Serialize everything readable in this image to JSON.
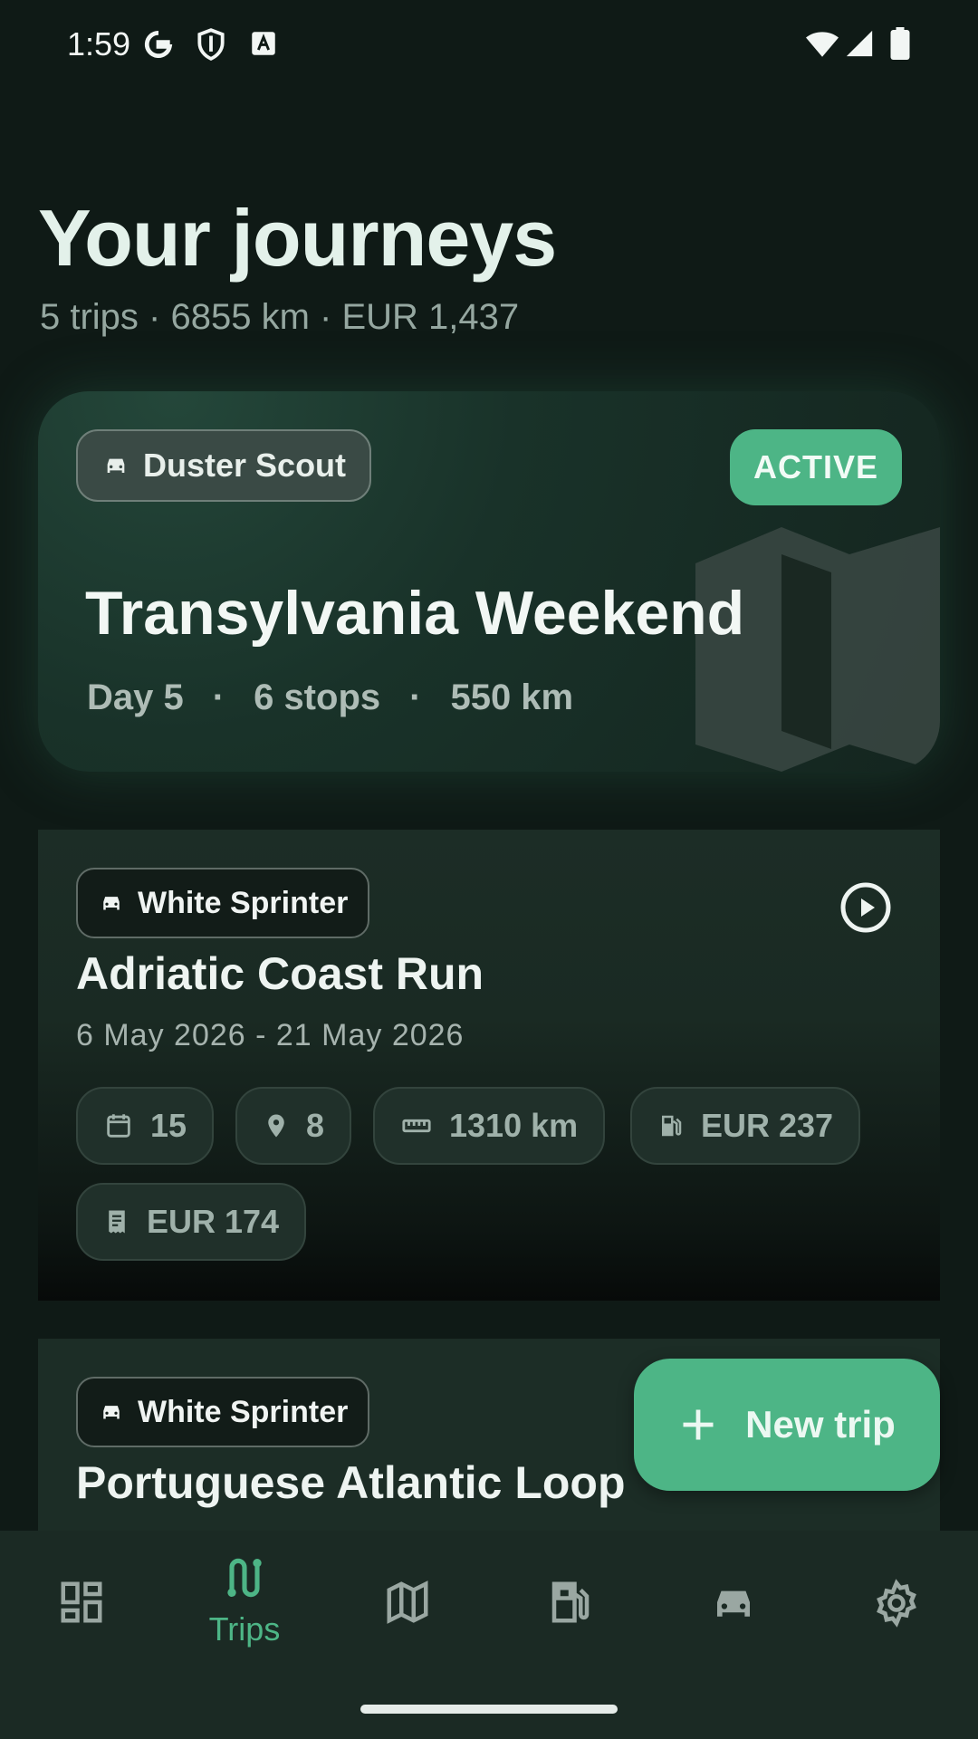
{
  "status": {
    "time": "1:59"
  },
  "header": {
    "title": "Your journeys",
    "summary": "5 trips · 6855 km · EUR 1,437"
  },
  "active_trip": {
    "vehicle": "Duster Scout",
    "badge": "ACTIVE",
    "title": "Transylvania Weekend",
    "day": "Day 5",
    "stops": "6 stops",
    "distance": "550 km",
    "separator": "·"
  },
  "trips": [
    {
      "vehicle": "White Sprinter",
      "title": "Adriatic Coast Run",
      "dates": "6 May 2026 - 21 May 2026",
      "chips": {
        "days": "15",
        "stops": "8",
        "distance": "1310 km",
        "fuel": "EUR 237",
        "tolls": "EUR 174"
      }
    },
    {
      "vehicle": "White Sprinter",
      "title": "Portuguese Atlantic Loop"
    }
  ],
  "fab": {
    "label": "New trip"
  },
  "nav": {
    "items": [
      {
        "icon": "dashboard-icon"
      },
      {
        "icon": "route-icon",
        "label": "Trips",
        "active": true
      },
      {
        "icon": "map-icon"
      },
      {
        "icon": "fuel-station-icon"
      },
      {
        "icon": "car-icon"
      },
      {
        "icon": "settings-icon"
      }
    ]
  },
  "colors": {
    "accent": "#4db586",
    "background": "#0f1a16",
    "card": "#1c2d26"
  }
}
